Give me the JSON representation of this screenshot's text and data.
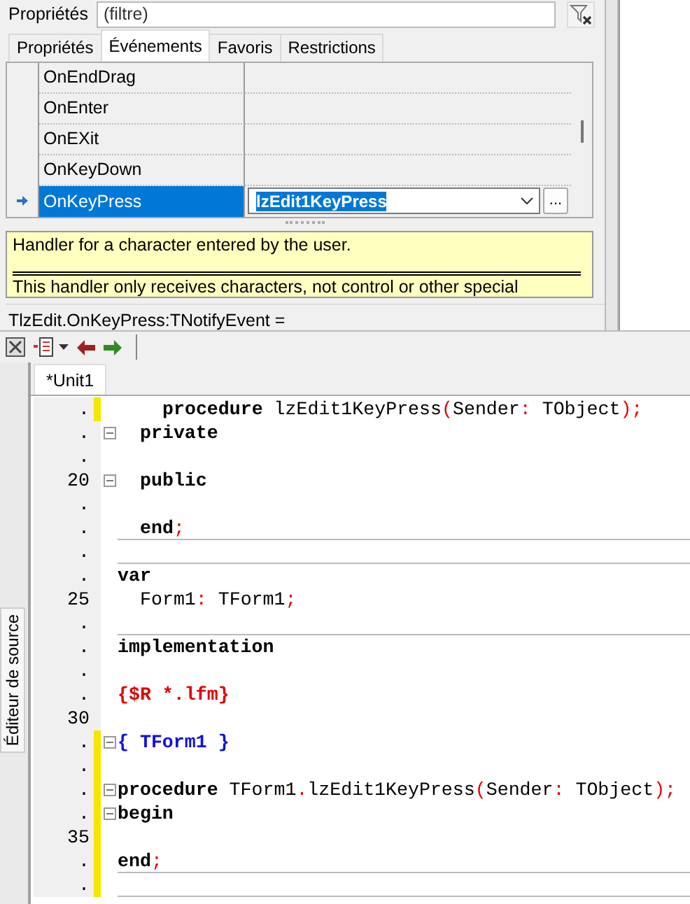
{
  "filter": {
    "label": "Propriétés",
    "placeholder": "(filtre)"
  },
  "tabs": [
    {
      "label": "Propriétés",
      "selected": false
    },
    {
      "label": "Événements",
      "selected": true
    },
    {
      "label": "Favoris",
      "selected": false
    },
    {
      "label": "Restrictions",
      "selected": false
    }
  ],
  "events": [
    {
      "name": "OnEndDrag",
      "selected": false
    },
    {
      "name": "OnEnter",
      "selected": false
    },
    {
      "name": "OnEXit",
      "selected": false
    },
    {
      "name": "OnKeyDown",
      "selected": false
    },
    {
      "name": "OnKeyPress",
      "selected": true,
      "value": "lzEdit1KeyPress",
      "edit_button": "..."
    }
  ],
  "hint": {
    "summary": "Handler for a character entered by the user.",
    "detail": "This handler only receives characters, not control or other special"
  },
  "status": "TlzEdit.OnKeyPress:TNotifyEvent =",
  "editor": {
    "side_tab": "Éditeur de source",
    "tabs": [
      {
        "label": "*Unit1",
        "selected": true
      }
    ],
    "lines": [
      {
        "number": ".",
        "modified": true,
        "fold": false,
        "rule_below": false,
        "kind": "deep",
        "tokens": [
          {
            "kind": "keyword",
            "text": "procedure"
          },
          {
            "kind": "text",
            "text": " lzEdit1KeyPress"
          },
          {
            "kind": "symbol",
            "text": "("
          },
          {
            "kind": "text",
            "text": "Sender"
          },
          {
            "kind": "symbol",
            "text": ":"
          },
          {
            "kind": "text",
            "text": " TObject"
          },
          {
            "kind": "symbol",
            "text": ");"
          }
        ]
      },
      {
        "number": ".",
        "modified": false,
        "fold": true,
        "rule_below": false,
        "kind": "indented",
        "tokens": [
          {
            "kind": "keyword",
            "text": "private"
          }
        ]
      },
      {
        "number": ".",
        "modified": false,
        "fold": false,
        "rule_below": false
      },
      {
        "number": "20",
        "modified": false,
        "fold": true,
        "rule_below": false,
        "kind": "indented",
        "tokens": [
          {
            "kind": "keyword",
            "text": "public"
          }
        ]
      },
      {
        "number": ".",
        "modified": false,
        "fold": false,
        "rule_below": false
      },
      {
        "number": ".",
        "modified": false,
        "fold": false,
        "rule_below": true,
        "kind": "indented",
        "tokens": [
          {
            "kind": "keyword",
            "text": "end"
          },
          {
            "kind": "symbol",
            "text": ";"
          }
        ]
      },
      {
        "number": ".",
        "modified": false,
        "fold": false,
        "rule_below": true
      },
      {
        "number": ".",
        "modified": false,
        "fold": false,
        "rule_below": false,
        "tokens": [
          {
            "kind": "keyword",
            "text": "var"
          }
        ]
      },
      {
        "number": "25",
        "modified": false,
        "fold": false,
        "rule_below": false,
        "kind": "indented",
        "tokens": [
          {
            "kind": "text",
            "text": "Form1"
          },
          {
            "kind": "symbol",
            "text": ":"
          },
          {
            "kind": "text",
            "text": " TForm1"
          },
          {
            "kind": "symbol",
            "text": ";"
          }
        ]
      },
      {
        "number": ".",
        "modified": false,
        "fold": false,
        "rule_below": true
      },
      {
        "number": ".",
        "modified": false,
        "fold": false,
        "rule_below": false,
        "tokens": [
          {
            "kind": "keyword",
            "text": "implementation"
          }
        ]
      },
      {
        "number": ".",
        "modified": false,
        "fold": false,
        "rule_below": false
      },
      {
        "number": ".",
        "modified": false,
        "fold": false,
        "rule_below": false,
        "tokens": [
          {
            "kind": "directive",
            "text": "{$R *.lfm}"
          }
        ]
      },
      {
        "number": "30",
        "modified": false,
        "fold": false,
        "rule_below": false
      },
      {
        "number": ".",
        "modified": true,
        "fold": true,
        "rule_below": false,
        "tokens": [
          {
            "kind": "comment",
            "text": "{ TForm1 }"
          }
        ]
      },
      {
        "number": ".",
        "modified": true,
        "fold": false,
        "rule_below": false
      },
      {
        "number": ".",
        "modified": true,
        "fold": true,
        "rule_below": false,
        "tokens": [
          {
            "kind": "keyword",
            "text": "procedure"
          },
          {
            "kind": "text",
            "text": " TForm1"
          },
          {
            "kind": "symbol",
            "text": "."
          },
          {
            "kind": "text",
            "text": "lzEdit1KeyPress"
          },
          {
            "kind": "symbol",
            "text": "("
          },
          {
            "kind": "text",
            "text": "Sender"
          },
          {
            "kind": "symbol",
            "text": ":"
          },
          {
            "kind": "text",
            "text": " TObject"
          },
          {
            "kind": "symbol",
            "text": ");"
          }
        ]
      },
      {
        "number": ".",
        "modified": true,
        "fold": true,
        "rule_below": false,
        "tokens": [
          {
            "kind": "keyword",
            "text": "begin"
          }
        ]
      },
      {
        "number": "35",
        "modified": true,
        "fold": false,
        "rule_below": false
      },
      {
        "number": ".",
        "modified": true,
        "fold": false,
        "rule_below": true,
        "tokens": [
          {
            "kind": "keyword",
            "text": "end"
          },
          {
            "kind": "symbol",
            "text": ";"
          }
        ]
      },
      {
        "number": ".",
        "modified": true,
        "fold": false,
        "rule_below": true
      }
    ]
  }
}
